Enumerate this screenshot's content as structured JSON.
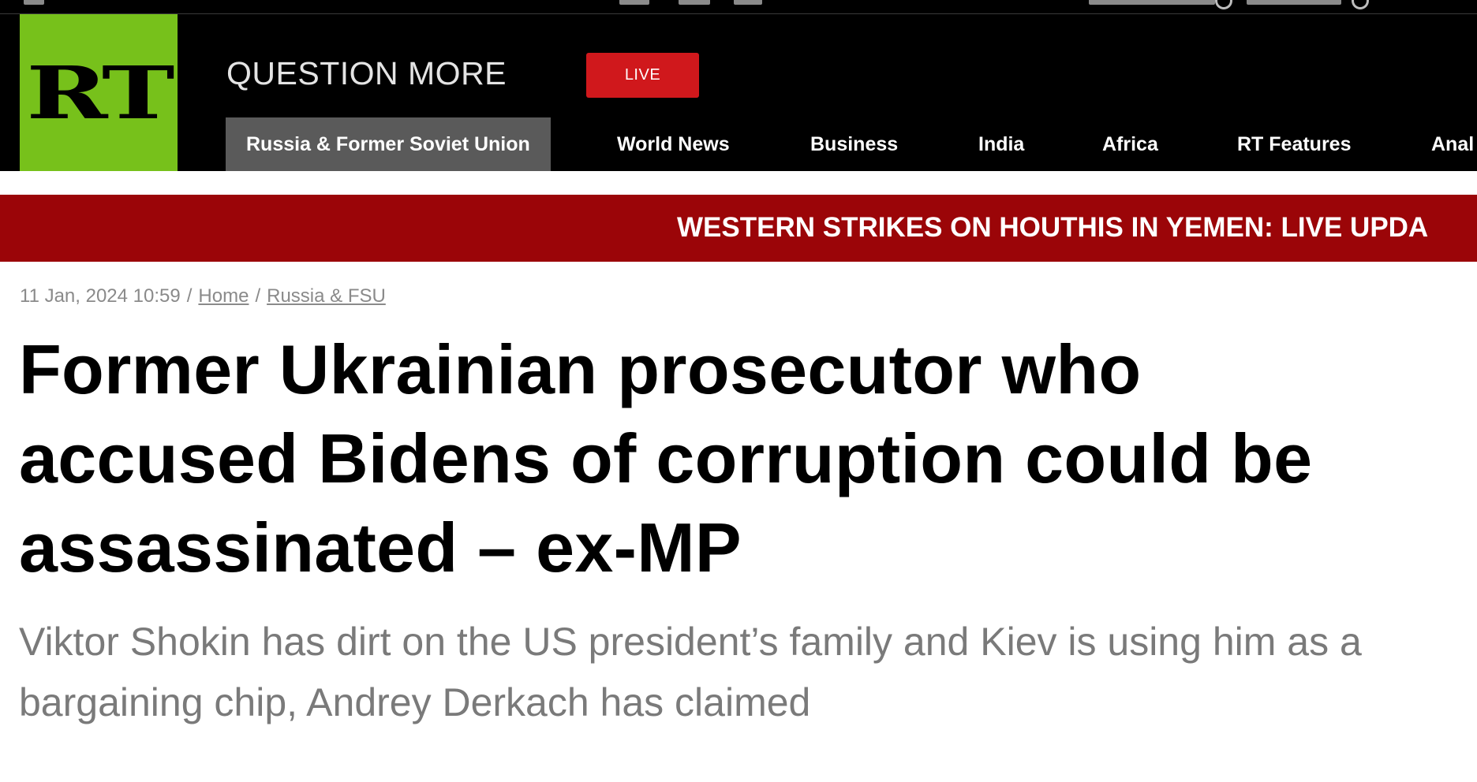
{
  "logo": {
    "text": "RT",
    "color": "#77c11b"
  },
  "slogan": "QUESTION MORE",
  "live_button": {
    "label": "LIVE",
    "color": "#d0181c"
  },
  "nav": {
    "items": [
      {
        "label": "Russia & Former Soviet Union",
        "active": true
      },
      {
        "label": "World News"
      },
      {
        "label": "Business"
      },
      {
        "label": "India"
      },
      {
        "label": "Africa"
      },
      {
        "label": "RT Features"
      },
      {
        "label": "Anal"
      }
    ]
  },
  "breaking_banner": {
    "text": "WESTERN STRIKES ON HOUTHIS IN YEMEN: LIVE UPDA",
    "color": "#9b0508"
  },
  "article": {
    "timestamp": "11 Jan, 2024 10:59",
    "breadcrumb": [
      "Home",
      "Russia & FSU"
    ],
    "separator": "/",
    "headline": "Former Ukrainian prosecutor who accused Bidens of corruption could be assassinated – ex-MP",
    "summary": "Viktor Shokin has dirt on the US president’s family and Kiev is using him as a bargaining chip, Andrey Derkach has claimed"
  }
}
